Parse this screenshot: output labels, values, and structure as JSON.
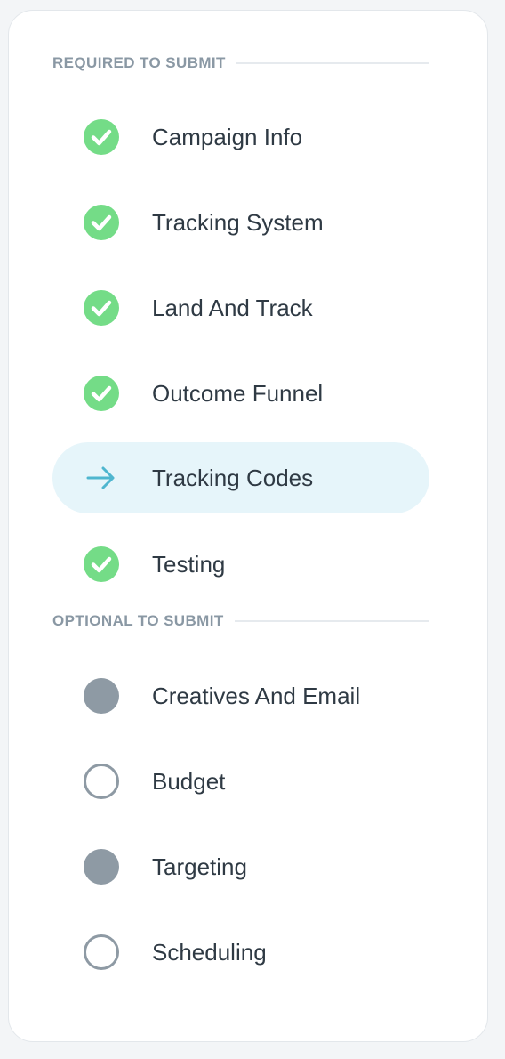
{
  "required_section": {
    "title": "REQUIRED TO SUBMIT",
    "items": [
      {
        "label": "Campaign Info",
        "status": "done",
        "icon": "check-circle-icon"
      },
      {
        "label": "Tracking System",
        "status": "done",
        "icon": "check-circle-icon"
      },
      {
        "label": "Land And Track",
        "status": "done",
        "icon": "check-circle-icon"
      },
      {
        "label": "Outcome Funnel",
        "status": "done",
        "icon": "check-circle-icon"
      },
      {
        "label": "Tracking Codes",
        "status": "current",
        "icon": "arrow-right-icon"
      },
      {
        "label": "Testing",
        "status": "done",
        "icon": "check-circle-icon"
      }
    ]
  },
  "optional_section": {
    "title": "OPTIONAL TO SUBMIT",
    "items": [
      {
        "label": "Creatives And Email",
        "status": "filled",
        "icon": "filled-circle-icon"
      },
      {
        "label": "Budget",
        "status": "empty",
        "icon": "empty-circle-icon"
      },
      {
        "label": "Targeting",
        "status": "filled",
        "icon": "filled-circle-icon"
      },
      {
        "label": "Scheduling",
        "status": "empty",
        "icon": "empty-circle-icon"
      }
    ]
  },
  "colors": {
    "done": "#74dc87",
    "current_bg": "#e6f5fa",
    "arrow": "#4fb6cf",
    "pending": "#8e9aa4"
  }
}
